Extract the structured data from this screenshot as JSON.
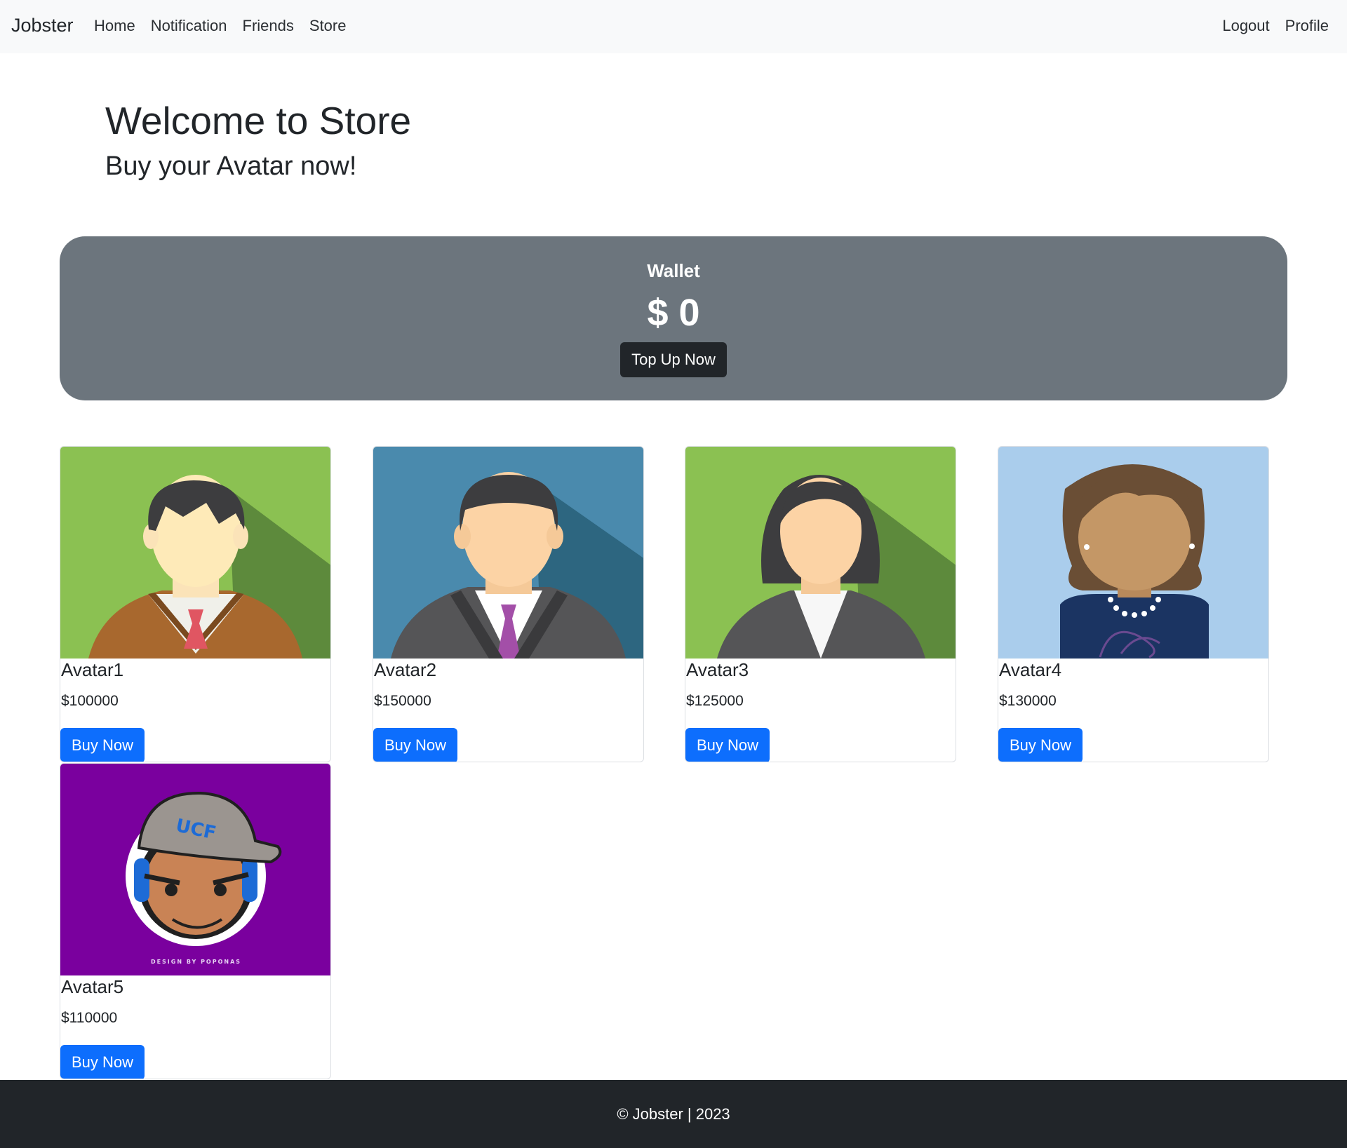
{
  "navbar": {
    "brand": "Jobster",
    "left_links": [
      "Home",
      "Notification",
      "Friends",
      "Store"
    ],
    "right_links": [
      "Logout",
      "Profile"
    ]
  },
  "hero": {
    "title": "Welcome to Store",
    "subtitle": "Buy your Avatar now!"
  },
  "wallet": {
    "label": "Wallet",
    "amount": "$ 0",
    "button_label": "Top Up Now"
  },
  "avatars": [
    {
      "name": "Avatar1",
      "price": "$100000",
      "button_label": "Buy Now",
      "icon": "young-man-brown-sweater-avatar",
      "bg": "#8bc152"
    },
    {
      "name": "Avatar2",
      "price": "$150000",
      "button_label": "Buy Now",
      "icon": "businessman-suit-avatar",
      "bg": "#4a8aad"
    },
    {
      "name": "Avatar3",
      "price": "$125000",
      "button_label": "Buy Now",
      "icon": "businesswoman-avatar",
      "bg": "#8bc152"
    },
    {
      "name": "Avatar4",
      "price": "$130000",
      "button_label": "Buy Now",
      "icon": "woman-navy-dress-avatar",
      "bg": "#aacdec"
    },
    {
      "name": "Avatar5",
      "price": "$110000",
      "button_label": "Buy Now",
      "icon": "cartoon-gamer-cap-avatar",
      "bg": "#7a009e",
      "logo_text": "DESIGN BY POPONAS"
    }
  ],
  "footer": {
    "text": "© Jobster | 2023"
  },
  "colors": {
    "navbar_bg": "#f8f9fa",
    "wallet_bg": "#6c757d",
    "primary_button": "#0d6efd",
    "dark_button": "#212529",
    "footer_bg": "#212529"
  }
}
